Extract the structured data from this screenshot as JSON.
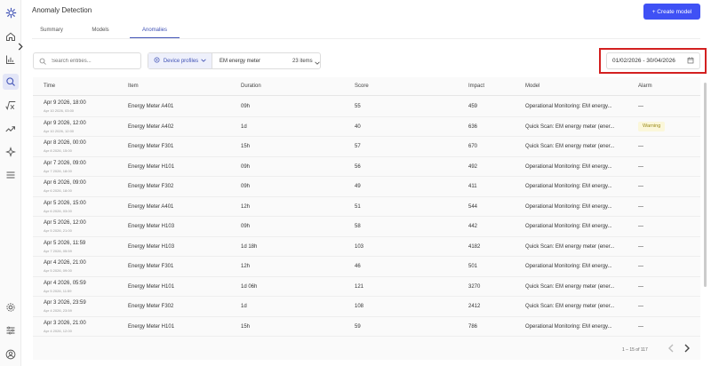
{
  "app_title": "Anomaly Detection",
  "create_button": "+ Create model",
  "tabs": [
    {
      "label": "Summary"
    },
    {
      "label": "Models"
    },
    {
      "label": "Anomalies"
    }
  ],
  "active_tab": "Anomalies",
  "search_placeholder": "Search entities...",
  "device_profiles_label": "Device profiles",
  "device_profile_value": "EM energy meter",
  "items_count": "23 items",
  "date_range": "01/02/2026 - 30/04/2026",
  "columns": [
    "Time",
    "Item",
    "Duration",
    "Score",
    "Impact",
    "Model",
    "Alarm"
  ],
  "rows": [
    {
      "time": "Apr 9 2026, 18:00",
      "time_sub": "Apr 10 2026, 03:00",
      "item": "Energy Meter A401",
      "duration": "09h",
      "score": "55",
      "impact": "459",
      "model": "Operational Monitoring: EM energy...",
      "alarm": "—"
    },
    {
      "time": "Apr 9 2026, 12:00",
      "time_sub": "Apr 10 2026, 12:00",
      "item": "Energy Meter A402",
      "duration": "1d",
      "score": "40",
      "impact": "636",
      "model": "Quick Scan: EM energy meter (ener...",
      "alarm": "Warning"
    },
    {
      "time": "Apr 8 2026, 00:00",
      "time_sub": "Apr 8 2026, 15:00",
      "item": "Energy Meter F301",
      "duration": "15h",
      "score": "57",
      "impact": "670",
      "model": "Quick Scan: EM energy meter (ener...",
      "alarm": "—"
    },
    {
      "time": "Apr 7 2026, 09:00",
      "time_sub": "Apr 7 2026, 18:00",
      "item": "Energy Meter H101",
      "duration": "09h",
      "score": "56",
      "impact": "492",
      "model": "Operational Monitoring: EM energy...",
      "alarm": "—"
    },
    {
      "time": "Apr 6 2026, 09:00",
      "time_sub": "Apr 6 2026, 18:00",
      "item": "Energy Meter F302",
      "duration": "09h",
      "score": "49",
      "impact": "411",
      "model": "Operational Monitoring: EM energy...",
      "alarm": "—"
    },
    {
      "time": "Apr 5 2026, 15:00",
      "time_sub": "Apr 6 2026, 03:00",
      "item": "Energy Meter A401",
      "duration": "12h",
      "score": "51",
      "impact": "544",
      "model": "Operational Monitoring: EM energy...",
      "alarm": "—"
    },
    {
      "time": "Apr 5 2026, 12:00",
      "time_sub": "Apr 5 2026, 21:00",
      "item": "Energy Meter H103",
      "duration": "09h",
      "score": "58",
      "impact": "442",
      "model": "Operational Monitoring: EM energy...",
      "alarm": "—"
    },
    {
      "time": "Apr 5 2026, 11:59",
      "time_sub": "Apr 7 2026, 05:59",
      "item": "Energy Meter H103",
      "duration": "1d 18h",
      "score": "103",
      "impact": "4182",
      "model": "Quick Scan: EM energy meter (ener...",
      "alarm": "—"
    },
    {
      "time": "Apr 4 2026, 21:00",
      "time_sub": "Apr 5 2026, 09:00",
      "item": "Energy Meter F301",
      "duration": "12h",
      "score": "46",
      "impact": "501",
      "model": "Operational Monitoring: EM energy...",
      "alarm": "—"
    },
    {
      "time": "Apr 4 2026, 05:59",
      "time_sub": "Apr 5 2026, 11:59",
      "item": "Energy Meter H101",
      "duration": "1d 06h",
      "score": "121",
      "impact": "3270",
      "model": "Quick Scan: EM energy meter (ener...",
      "alarm": "—"
    },
    {
      "time": "Apr 3 2026, 23:59",
      "time_sub": "Apr 4 2026, 23:59",
      "item": "Energy Meter F302",
      "duration": "1d",
      "score": "108",
      "impact": "2412",
      "model": "Quick Scan: EM energy meter (ener...",
      "alarm": "—"
    },
    {
      "time": "Apr 3 2026, 21:00",
      "time_sub": "Apr 4 2026, 12:00",
      "item": "Energy Meter H101",
      "duration": "15h",
      "score": "59",
      "impact": "786",
      "model": "Operational Monitoring: EM energy...",
      "alarm": "—"
    }
  ],
  "pagination": "1 – 15 of 117",
  "colors": {
    "accent": "#3f51f5",
    "highlight": "#d32020",
    "warning_bg": "#fbf7da"
  }
}
